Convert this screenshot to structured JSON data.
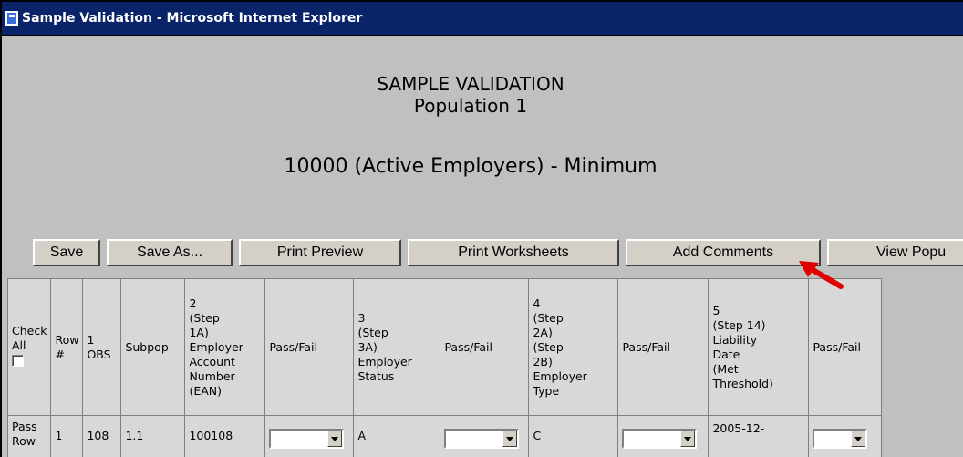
{
  "window": {
    "title": "Sample Validation - Microsoft Internet Explorer"
  },
  "page": {
    "heading_line1": "SAMPLE VALIDATION",
    "heading_line2": "Population 1",
    "subheading": "10000 (Active Employers) - Minimum"
  },
  "toolbar": {
    "save": "Save",
    "save_as": "Save As...",
    "print_preview": "Print Preview",
    "print_worksheets": "Print Worksheets",
    "add_comments": "Add Comments",
    "view_population": "View Popu"
  },
  "table": {
    "headers": {
      "check_all": "Check\nAll",
      "row": "Row\n#",
      "obs": "1\nOBS",
      "subpop": "Subpop",
      "ean": "2\n(Step\n1A)\nEmployer\nAccount\nNumber\n(EAN)",
      "pass_fail_1": "Pass/Fail",
      "employer_status": "3\n(Step\n3A)\nEmployer\nStatus",
      "pass_fail_2": "Pass/Fail",
      "employer_type": "4\n(Step\n2A)\n(Step\n2B)\nEmployer\nType",
      "pass_fail_3": "Pass/Fail",
      "liability_date": "5\n(Step 14)\nLiability\nDate\n(Met\nThreshold)",
      "pass_fail_4": "Pass/Fail"
    },
    "row1": {
      "pass_row": "Pass\nRow",
      "row": "1",
      "obs": "108",
      "subpop": "1.1",
      "ean": "100108",
      "employer_status": "A",
      "employer_type": "C",
      "liability_date": "2005-12-"
    }
  },
  "colors": {
    "titlebar": "#0a246a",
    "background": "#c0c0c0",
    "arrow": "#e00000"
  }
}
